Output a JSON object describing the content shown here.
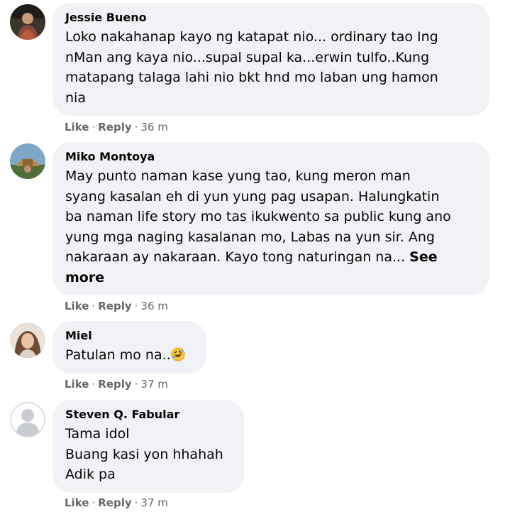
{
  "actions": {
    "like": "Like",
    "reply": "Reply",
    "separator": "·"
  },
  "comments": [
    {
      "author": "Jessie Bueno",
      "lines": [
        "Loko nakahanap kayo ng katapat nio... ordinary tao Ing",
        "nMan ang kaya nio...supal supal ka...erwin tulfo..Kung",
        "matapang talaga lahi nio bkt hnd mo laban ung hamon",
        "nia"
      ],
      "time": "36 m",
      "avatar_icon": "profile-photo-icon"
    },
    {
      "author": "Miko Montoya",
      "lines": [
        "May punto naman kase yung tao, kung meron man",
        "syang kasalan eh di yun yung pag usapan. Halungkatin",
        "ba naman life story mo tas ikukwento sa public kung ano",
        "yung mga naging kasalanan mo, Labas na yun sir. Ang",
        "nakaraan ay nakaraan. Kayo tong naturingan na..."
      ],
      "see_more_part1": "See",
      "see_more_part2": "more",
      "time": "36 m",
      "avatar_icon": "profile-photo-icon"
    },
    {
      "author": "Miel",
      "lines": [
        "Patulan mo na.."
      ],
      "emoji": "rolling-on-floor-laughing-emoji",
      "time": "37 m",
      "avatar_icon": "profile-photo-icon"
    },
    {
      "author": "Steven Q. Fabular",
      "lines": [
        "Tama idol",
        "Buang kasi yon hhahah",
        "Adik pa"
      ],
      "time": "37 m",
      "avatar_icon": "default-avatar-icon"
    }
  ]
}
